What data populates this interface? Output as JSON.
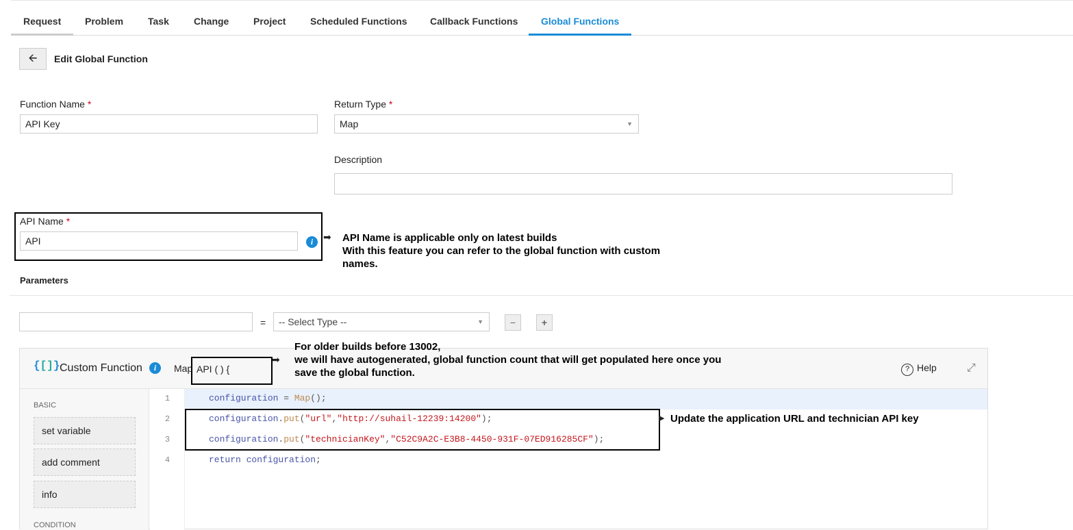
{
  "tabs": [
    "Request",
    "Problem",
    "Task",
    "Change",
    "Project",
    "Scheduled Functions",
    "Callback Functions",
    "Global Functions"
  ],
  "page_title": "Edit Global Function",
  "form": {
    "function_name_label": "Function Name",
    "function_name_value": "API Key",
    "return_type_label": "Return Type",
    "return_type_value": "Map",
    "description_label": "Description",
    "description_value": "",
    "api_name_label": "API Name",
    "api_name_value": "API",
    "required_mark": "*",
    "parameters_label": "Parameters",
    "equals": "=",
    "select_type": "-- Select Type --",
    "minus": "−",
    "plus": "+"
  },
  "notes": {
    "api_name": [
      "API Name is applicable only on latest builds",
      "With this feature you can refer to the global function with custom",
      "names."
    ],
    "older_builds": [
      "For older builds before 13002,",
      "we will have autogenerated, global function count that will get populated here once you",
      "save the global function."
    ],
    "update": "Update the  application URL and  technician API key"
  },
  "editor": {
    "title": "Custom Function",
    "sig_prefix": "Map",
    "sig": "API ( ) {",
    "help": "Help",
    "sections": {
      "basic": "BASIC",
      "condition": "CONDITION"
    },
    "items": [
      "set variable",
      "add comment",
      "info"
    ],
    "lines": [
      {
        "n": "1",
        "parts": [
          [
            "v",
            "configuration"
          ],
          [
            "p",
            " = "
          ],
          [
            "f",
            "Map"
          ],
          [
            "p",
            "();"
          ]
        ]
      },
      {
        "n": "2",
        "parts": [
          [
            "v",
            "configuration"
          ],
          [
            "p",
            "."
          ],
          [
            "f",
            "put"
          ],
          [
            "p",
            "("
          ],
          [
            "s",
            "\"url\""
          ],
          [
            "p",
            ","
          ],
          [
            "s",
            "\"http://suhail-12239:14200\""
          ],
          [
            "p",
            ");"
          ]
        ]
      },
      {
        "n": "3",
        "parts": [
          [
            "v",
            "configuration"
          ],
          [
            "p",
            "."
          ],
          [
            "f",
            "put"
          ],
          [
            "p",
            "("
          ],
          [
            "s",
            "\"technicianKey\""
          ],
          [
            "p",
            ","
          ],
          [
            "s",
            "\"C52C9A2C-E3B8-4450-931F-07ED916285CF\""
          ],
          [
            "p",
            ");"
          ]
        ]
      },
      {
        "n": "4",
        "parts": [
          [
            "v",
            "return configuration"
          ],
          [
            "p",
            ";"
          ]
        ]
      }
    ]
  }
}
